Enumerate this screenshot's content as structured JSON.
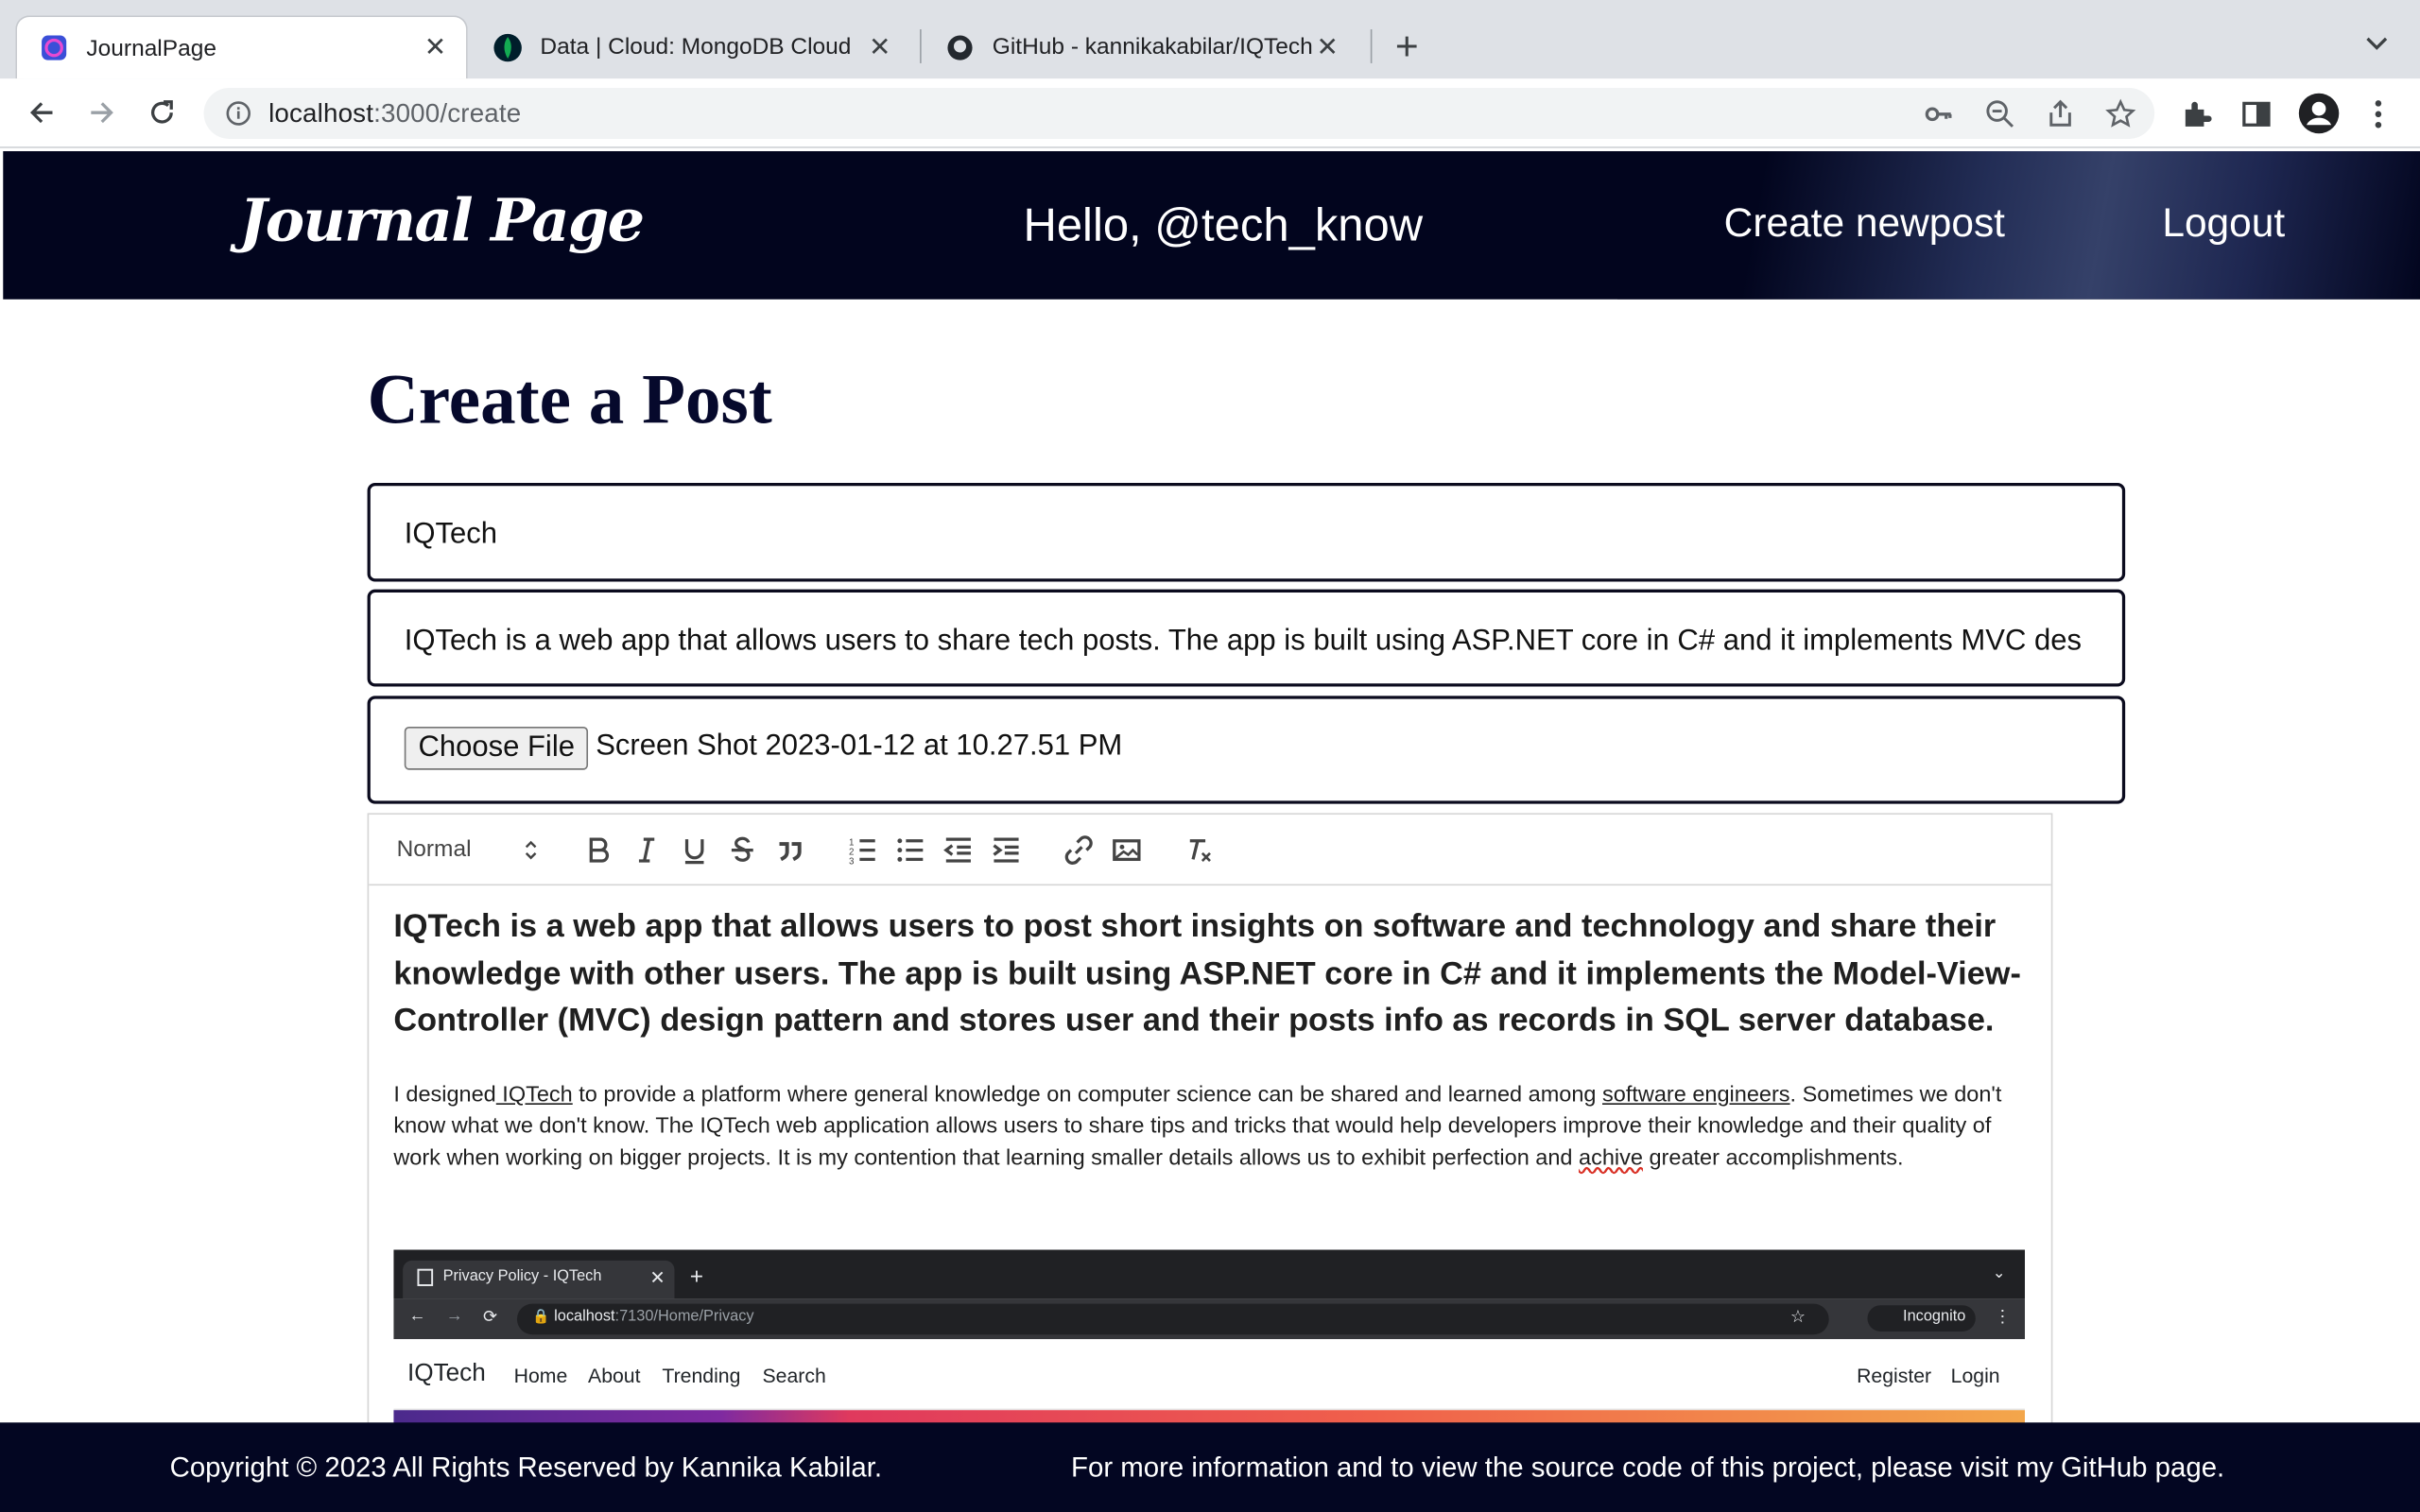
{
  "browser": {
    "tabs": [
      {
        "title": "JournalPage"
      },
      {
        "title": "Data | Cloud: MongoDB Cloud"
      },
      {
        "title": "GitHub - kannikakabilar/IQTech"
      }
    ],
    "url_host": "localhost",
    "url_rest": ":3000/create"
  },
  "header": {
    "logo": "Journal Page",
    "greeting": "Hello, @tech_know",
    "create_link": "Create newpost",
    "logout_link": "Logout"
  },
  "form": {
    "page_title": "Create a Post",
    "title_value": "IQTech",
    "summary_value": "IQTech is a web app that allows users to share tech posts. The app is built using ASP.NET core in C# and it implements MVC des",
    "file_button": "Choose File",
    "file_name": "Screen Shot 2023-01-12 at 10.27.51 PM"
  },
  "editor": {
    "format_select": "Normal",
    "heading": "IQTech is a web app that allows users to post short insights on software and technology and share their knowledge with other users. The app is built using ASP.NET core in C# and it implements the Model-View-Controller (MVC) design pattern and stores user and their posts info as records in SQL server database.",
    "para_1": "I designed",
    "para_link_1": " IQTech",
    "para_2": " to provide a platform where general knowledge on computer science can be shared and learned among ",
    "para_link_2": "software engineers",
    "para_3": ". Sometimes we don't know what we don't know. The IQTech web application allows users to share tips and tricks that would help developers improve their knowledge and their quality of work when working on bigger projects. It is my contention that learning smaller details allows us to exhibit perfection and ",
    "para_misspelled": "achive",
    "para_4": " greater accomplishments.",
    "screenshot": {
      "tab_title": "Privacy Policy - IQTech",
      "url_host": "localhost",
      "url_rest": ":7130/Home/Privacy",
      "incognito": "Incognito",
      "brand": "IQTech",
      "nav": [
        "Home",
        "About",
        "Trending",
        "Search"
      ],
      "register": "Register",
      "login": "Login"
    }
  },
  "footer": {
    "copyright": "Copyright © 2023 All Rights Reserved by Kannika Kabilar.",
    "info": "For more information and to view the source code of this project, please visit my GitHub page."
  }
}
